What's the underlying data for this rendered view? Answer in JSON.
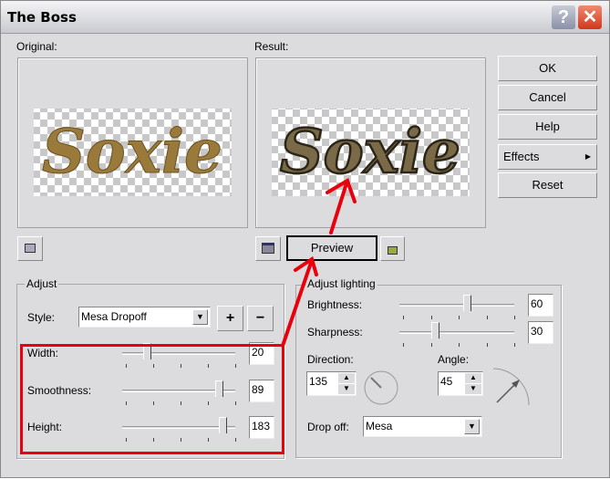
{
  "window": {
    "title": "The Boss"
  },
  "previews": {
    "original_label": "Original:",
    "result_label": "Result:",
    "sample_text": "Soxie"
  },
  "buttons": {
    "ok": "OK",
    "cancel": "Cancel",
    "help": "Help",
    "effects": "Effects",
    "reset": "Reset",
    "preview": "Preview",
    "plus": "+",
    "minus": "−"
  },
  "adjust": {
    "title": "Adjust",
    "style_label": "Style:",
    "style_value": "Mesa Dropoff",
    "sliders": [
      {
        "label": "Width:",
        "value": "20",
        "fraction": 0.2
      },
      {
        "label": "Smoothness:",
        "value": "89",
        "fraction": 0.89
      },
      {
        "label": "Height:",
        "value": "183",
        "fraction": 0.92
      }
    ]
  },
  "lighting": {
    "title": "Adjust lighting",
    "sliders": [
      {
        "label": "Brightness:",
        "value": "60",
        "fraction": 0.6
      },
      {
        "label": "Sharpness:",
        "value": "30",
        "fraction": 0.3
      }
    ],
    "direction_label": "Direction:",
    "direction_value": "135",
    "angle_label": "Angle:",
    "angle_value": "45",
    "dropoff_label": "Drop off:",
    "dropoff_value": "Mesa"
  },
  "colors": {
    "annotation": "#e8000c"
  }
}
